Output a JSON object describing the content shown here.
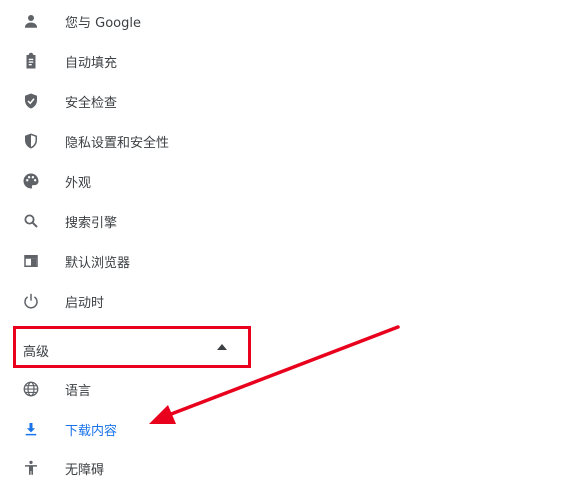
{
  "menu": {
    "items": [
      {
        "label": "您与 Google",
        "icon": "person-icon"
      },
      {
        "label": "自动填充",
        "icon": "clipboard-icon"
      },
      {
        "label": "安全检查",
        "icon": "shield-check-icon"
      },
      {
        "label": "隐私设置和安全性",
        "icon": "shield-half-icon"
      },
      {
        "label": "外观",
        "icon": "palette-icon"
      },
      {
        "label": "搜索引擎",
        "icon": "search-icon"
      },
      {
        "label": "默认浏览器",
        "icon": "browser-window-icon"
      },
      {
        "label": "启动时",
        "icon": "power-icon"
      }
    ],
    "advanced": {
      "label": "高级",
      "expanded": true
    },
    "advanced_items": [
      {
        "label": "语言",
        "icon": "globe-icon"
      },
      {
        "label": "下载内容",
        "icon": "download-icon",
        "selected": true
      },
      {
        "label": "无障碍",
        "icon": "accessibility-icon"
      }
    ]
  },
  "colors": {
    "text": "#3c4043",
    "icon": "#5f6368",
    "selected": "#1a73e8",
    "annotation": "#e8001c"
  }
}
